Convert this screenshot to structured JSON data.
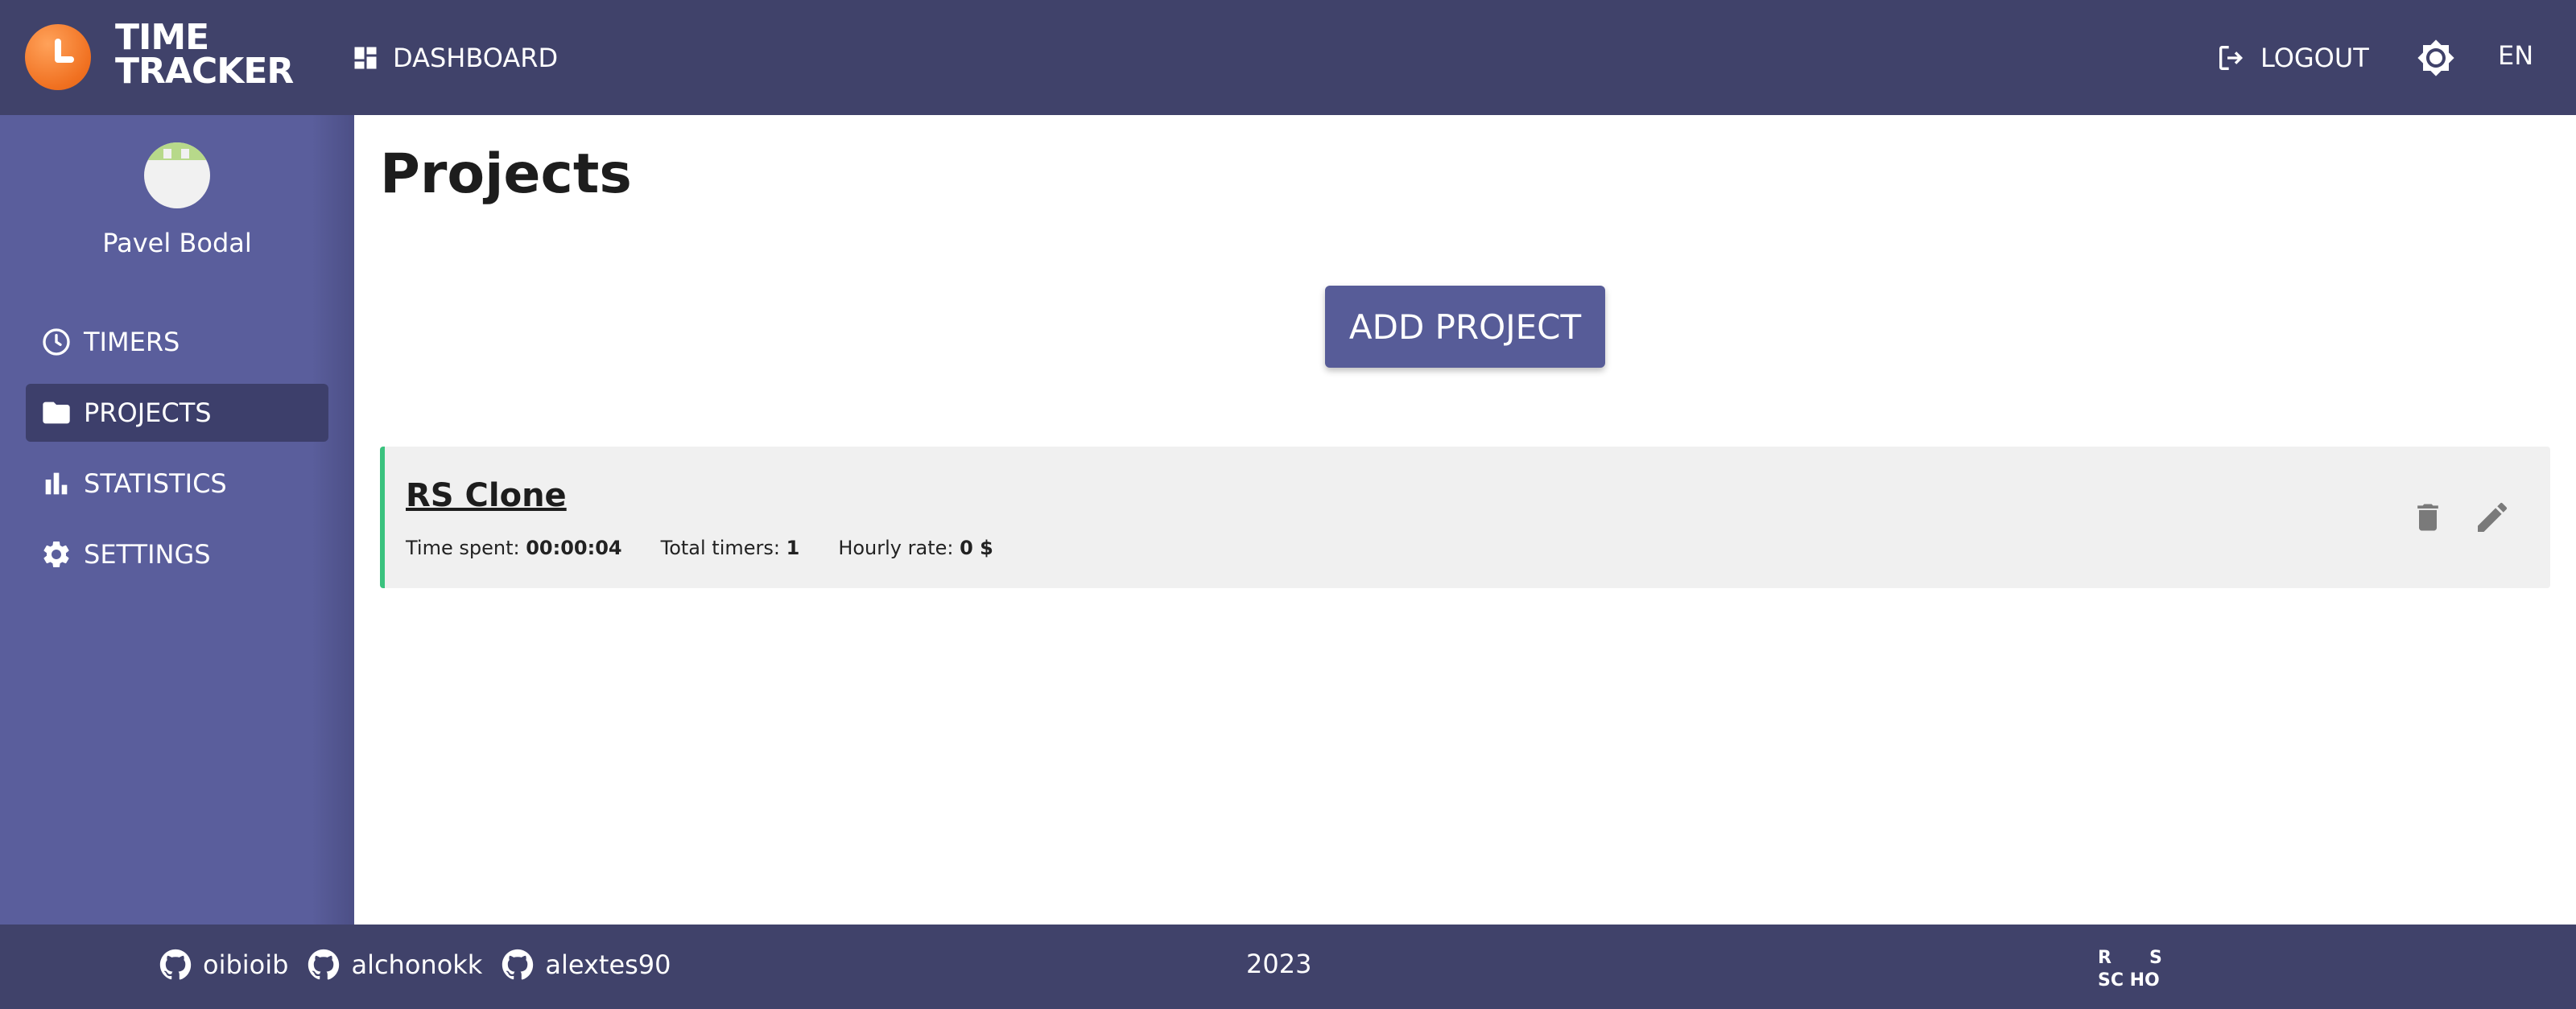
{
  "app": {
    "logo_line1": "TIME",
    "logo_line2": "TRACKER"
  },
  "header": {
    "dashboard_label": "DASHBOARD",
    "logout_label": "LOGOUT",
    "language": "EN"
  },
  "user": {
    "name": "Pavel Bodal"
  },
  "sidebar": {
    "items": [
      {
        "label": "TIMERS",
        "icon": "clock-icon",
        "active": false
      },
      {
        "label": "PROJECTS",
        "icon": "folder-icon",
        "active": true
      },
      {
        "label": "STATISTICS",
        "icon": "bar-chart-icon",
        "active": false
      },
      {
        "label": "SETTINGS",
        "icon": "gear-icon",
        "active": false
      }
    ]
  },
  "main": {
    "title": "Projects",
    "add_button": "ADD PROJECT",
    "projects": [
      {
        "name": "RS Clone",
        "time_spent_label": "Time spent:",
        "time_spent": "00:00:04",
        "total_timers_label": "Total timers:",
        "total_timers": "1",
        "hourly_rate_label": "Hourly rate:",
        "hourly_rate": "0 $",
        "accent_color": "#3ac27e"
      }
    ]
  },
  "footer": {
    "github_users": [
      "oibioib",
      "alchonokk",
      "alextes90"
    ],
    "year": "2023",
    "school_logo": "RS SCHOOL"
  },
  "colors": {
    "header": "#40426a",
    "sidebar": "#5a5e9c",
    "accent": "#575c98",
    "logo_orange": "#f07020"
  }
}
